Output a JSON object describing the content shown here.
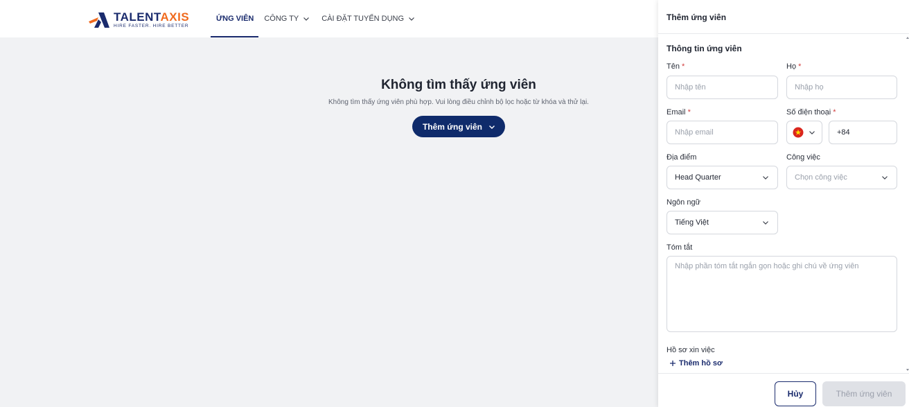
{
  "logo": {
    "name_part1": "TALENT",
    "name_part2": "AXIS",
    "tagline": "HIRE FASTER. HIRE BETTER"
  },
  "nav": {
    "items": [
      {
        "label": "ỨNG VIÊN",
        "active": true
      },
      {
        "label": "CÔNG TY",
        "dropdown": true
      },
      {
        "label": "CÀI ĐẶT TUYỂN DỤNG",
        "dropdown": true
      }
    ]
  },
  "empty_state": {
    "title": "Không tìm thấy ứng viên",
    "description": "Không tìm thấy ứng viên phù hợp. Vui lòng điều chỉnh bộ lọc hoặc từ khóa và thử lại.",
    "button_label": "Thêm ứng viên"
  },
  "drawer": {
    "title": "Thêm ứng viên",
    "section_title": "Thông tin ứng viên",
    "first_name": {
      "label": "Tên",
      "placeholder": "Nhập tên"
    },
    "last_name": {
      "label": "Họ",
      "placeholder": "Nhập họ"
    },
    "email": {
      "label": "Email",
      "placeholder": "Nhập email"
    },
    "phone": {
      "label": "Số điện thoại",
      "code": "+84"
    },
    "location": {
      "label": "Địa điểm",
      "value": "Head Quarter"
    },
    "job": {
      "label": "Công việc",
      "placeholder": "Chọn công việc"
    },
    "language": {
      "label": "Ngôn ngữ",
      "value": "Tiếng Việt"
    },
    "summary": {
      "label": "Tóm tắt",
      "placeholder": "Nhập phần tóm tắt ngắn gọn hoặc ghi chú về ứng viên"
    },
    "resume": {
      "label": "Hồ sơ xin việc",
      "add_label": "Thêm hồ sơ"
    },
    "cancel_label": "Hủy",
    "submit_label": "Thêm ứng viên",
    "required_mark": "*"
  },
  "colors": {
    "brand_navy": "#0f2b6b",
    "brand_orange": "#f06a1e",
    "required_red": "#d13b3b"
  }
}
